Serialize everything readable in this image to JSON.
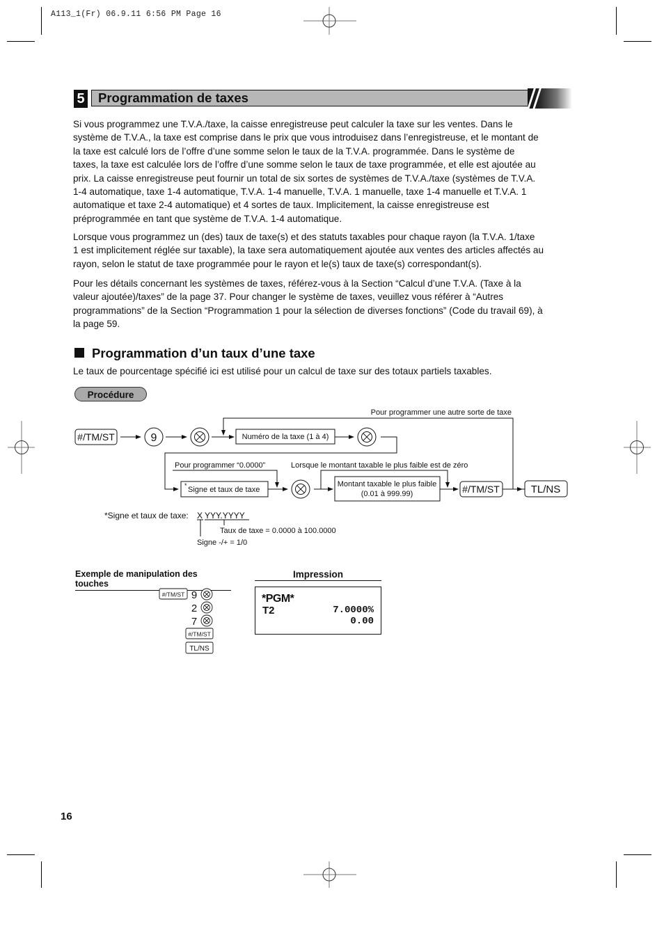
{
  "slug": "A113_1(Fr)   06.9.11 6:56 PM   Page 16",
  "section": {
    "number": "5",
    "title": "Programmation de taxes"
  },
  "paragraphs": [
    [
      "Si vous programmez une T.V.A./taxe, la caisse enregistreuse peut calculer la taxe sur les ventes. Dans le",
      "système de T.V.A., la taxe est comprise dans le prix que vous introduisez dans l’enregistreuse, et le montant de",
      "la taxe est calculé lors de l’offre d’une somme selon le taux de la T.V.A. programmée. Dans le système de",
      "taxes, la taxe est calculée lors de l’offre d’une somme selon le taux de taxe programmée, et elle est ajoutée au",
      "prix. La caisse enregistreuse peut fournir un total de six sortes de systèmes de T.V.A./taxe (systèmes de T.V.A.",
      "1-4 automatique, taxe 1-4 automatique, T.V.A. 1-4 manuelle, T.V.A. 1 manuelle, taxe 1-4 manuelle et T.V.A. 1",
      "automatique et taxe 2-4 automatique) et 4 sortes de taux. Implicitement, la caisse enregistreuse est",
      "préprogrammée en tant que système de T.V.A. 1-4 automatique."
    ],
    [
      "Lorsque vous programmez un (des) taux de taxe(s) et des statuts taxables pour chaque rayon (la T.V.A. 1/taxe",
      "1 est implicitement réglée sur taxable), la taxe sera automatiquement ajoutée aux ventes des articles affectés au",
      "rayon, selon le statut de taxe programmée pour le rayon et le(s) taux de taxe(s) correspondant(s)."
    ],
    [
      "Pour les détails concernant les systèmes de taxes, référez-vous à la Section “Calcul d’une T.V.A. (Taxe à la",
      "valeur ajoutée)/taxes” de la page 37. Pour changer le système de taxes, veuillez vous référer à “Autres",
      "programmations” de la Section “Programmation 1 pour la sélection de diverses fonctions” (Code du travail 69), à",
      "la page 59."
    ]
  ],
  "subsection": {
    "title": "Programmation d’un taux d’une taxe",
    "intro": "Le taux de pourcentage spécifié ici est utilisé pour un calcul de taxe sur des totaux partiels taxables.",
    "procedure_label": "Procédure"
  },
  "diagram": {
    "key_tmst": "#/TM/ST",
    "key_9": "9",
    "box_tax_number": "Numéro de la taxe (1 à 4)",
    "loop_label": "Pour programmer une autre sorte de taxe",
    "zero_label": "Pour programmer “0.0000”",
    "min_zero_label": "Lorsque le montant taxable le plus faible est de zéro",
    "box_sign_rate_star": "*",
    "box_sign_rate": "Signe et taux de taxe",
    "box_min_amount_1": "Montant taxable le plus faible",
    "box_min_amount_2": "(0.01 à 999.99)",
    "key_tmst_2": "#/TM/ST",
    "key_tlns": "TL/NS",
    "multiply_icon": "circled-times"
  },
  "footnote": {
    "label": "*Signe et taux de taxe:",
    "x": "X",
    "y": "YYY.YYYY",
    "rate_note": "Taux de taxe = 0.0000 à 100.0000",
    "sign_note": "Signe -/+ = 1/0"
  },
  "example": {
    "title": "Exemple de manipulation des touches",
    "rows": [
      {
        "key": "#/TM/ST",
        "digit": "9",
        "x": true
      },
      {
        "key": "",
        "digit": "2",
        "x": true
      },
      {
        "key": "",
        "digit": "7",
        "x": true
      },
      {
        "key": "#/TM/ST",
        "digit": "",
        "x": false
      },
      {
        "key": "TL/NS",
        "digit": "",
        "x": false
      }
    ],
    "key_r1": "#/TM/ST",
    "d1": "9",
    "d2": "2",
    "d3": "7",
    "key_r4": "#/TM/ST",
    "key_r5": "TL/NS"
  },
  "impression": {
    "title": "Impression",
    "line1": "*PGM*",
    "line2_left": "T2",
    "line2_right": "7.0000%",
    "line3_right": "0.00"
  },
  "page_number": "16"
}
